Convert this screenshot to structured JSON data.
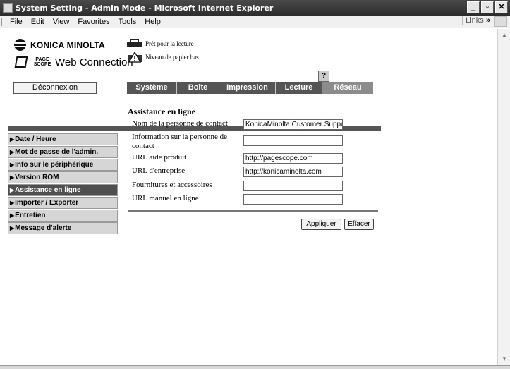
{
  "window": {
    "title": "System Setting - Admin Mode - Microsoft Internet Explorer"
  },
  "menubar": {
    "items": [
      "File",
      "Edit",
      "View",
      "Favorites",
      "Tools",
      "Help"
    ],
    "links_label": "Links"
  },
  "logos": {
    "brand": "KONICA MINOLTA",
    "pagescope_small": "PAGE SCOPE",
    "product": "Web Connection"
  },
  "status": {
    "ready": "Prêt pour la lecture",
    "paper_low": "Niveau de papier bas",
    "help": "?"
  },
  "logout_label": "Déconnexion",
  "tabs": [
    {
      "label": "Système"
    },
    {
      "label": "Boîte"
    },
    {
      "label": "Impression"
    },
    {
      "label": "Lecture"
    },
    {
      "label": "Réseau"
    }
  ],
  "sidebar": {
    "items": [
      {
        "label": "Date / Heure"
      },
      {
        "label": "Mot de passe de l'admin."
      },
      {
        "label": "Info sur le périphérique"
      },
      {
        "label": "Version ROM"
      },
      {
        "label": "Assistance en ligne"
      },
      {
        "label": "Importer / Exporter"
      },
      {
        "label": "Entretien"
      },
      {
        "label": "Message d'alerte"
      }
    ]
  },
  "form": {
    "title": "Assistance en ligne",
    "rows": [
      {
        "label": "Nom de la personne de contact",
        "value": "KonicaMinolta Customer Support"
      },
      {
        "label": "Information sur la personne de contact",
        "value": ""
      },
      {
        "label": "URL aide produit",
        "value": "http://pagescope.com"
      },
      {
        "label": "URL d'entreprise",
        "value": "http://konicaminolta.com"
      },
      {
        "label": "Fournitures et accessoires",
        "value": ""
      },
      {
        "label": "URL manuel en ligne",
        "value": ""
      }
    ],
    "apply_label": "Appliquer",
    "clear_label": "Effacer"
  },
  "colors": {
    "tab_bg": "#555555",
    "tab_active": "#8c8c8c",
    "sidebar_active": "#4f4f4f",
    "sidebar_bg": "#d6d6d6"
  }
}
